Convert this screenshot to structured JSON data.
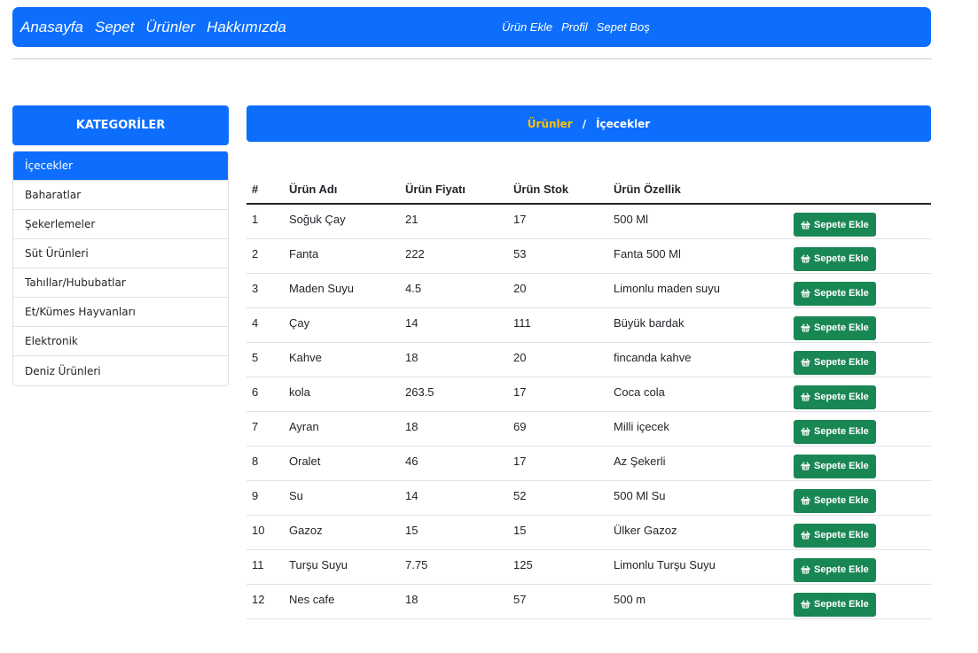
{
  "navbar": {
    "left_links": [
      "Anasayfa",
      "Sepet",
      "Ürünler",
      "Hakkımızda"
    ],
    "right_links": [
      "Ürün Ekle",
      "Profil",
      "Sepet Boş"
    ]
  },
  "sidebar": {
    "title": "KATEGORİLER",
    "active_index": 0,
    "items": [
      "İçecekler",
      "Baharatlar",
      "Şekerlemeler",
      "Süt Ürünleri",
      "Tahıllar/Hububatlar",
      "Et/Kümes Hayvanları",
      "Elektronik",
      "Deniz Ürünleri"
    ]
  },
  "breadcrumb": {
    "link": "Ürünler",
    "separator": "/",
    "current": "İçecekler"
  },
  "table": {
    "headers": [
      "#",
      "Ürün Adı",
      "Ürün Fiyatı",
      "Ürün Stok",
      "Ürün Özellik",
      ""
    ],
    "button_label": "Sepete Ekle",
    "button_icon": "basket-icon",
    "rows": [
      [
        "1",
        "Soğuk Çay",
        "21",
        "17",
        "500 Ml"
      ],
      [
        "2",
        "Fanta",
        "222",
        "53",
        "Fanta 500 Ml"
      ],
      [
        "3",
        "Maden Suyu",
        "4.5",
        "20",
        "Limonlu maden suyu"
      ],
      [
        "4",
        "Çay",
        "14",
        "111",
        "Büyük bardak"
      ],
      [
        "5",
        "Kahve",
        "18",
        "20",
        "fincanda kahve"
      ],
      [
        "6",
        "kola",
        "263.5",
        "17",
        "Coca cola"
      ],
      [
        "7",
        "Ayran",
        "18",
        "69",
        "Milli içecek"
      ],
      [
        "8",
        "Oralet",
        "46",
        "17",
        "Az Şekerli"
      ],
      [
        "9",
        "Su",
        "14",
        "52",
        "500 Ml Su"
      ],
      [
        "10",
        "Gazoz",
        "15",
        "15",
        "Ülker Gazoz"
      ],
      [
        "11",
        "Turşu Suyu",
        "7.75",
        "125",
        "Limonlu Turşu Suyu"
      ],
      [
        "12",
        "Nes cafe",
        "18",
        "57",
        "500 m"
      ]
    ]
  },
  "colors": {
    "primary": "#0d6efd",
    "success": "#198754",
    "accent": "#ffc107"
  }
}
